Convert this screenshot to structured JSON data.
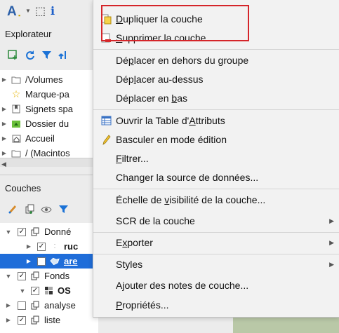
{
  "left_panel": {
    "toolbar_glyph": "A",
    "explorer_title": "Explorateur",
    "explorer_items": [
      {
        "label": "/Volumes",
        "icon": "folder-icon"
      },
      {
        "label": "Marque-pa",
        "icon": "star-icon"
      },
      {
        "label": "Signets spa",
        "icon": "bookmark-icon"
      },
      {
        "label": "Dossier du",
        "icon": "home-folder-icon"
      },
      {
        "label": "Accueil",
        "icon": "home-icon"
      },
      {
        "label": "/ (Macintos",
        "icon": "folder-icon"
      }
    ],
    "layers_title": "Couches",
    "layer_items": [
      {
        "label": "Donné"
      },
      {
        "label": "ruc"
      },
      {
        "label": "are"
      },
      {
        "label": "Fonds"
      },
      {
        "label": "OS"
      },
      {
        "label": "analyse"
      },
      {
        "label": "liste"
      }
    ]
  },
  "context_menu": {
    "items": [
      {
        "label": "Dupliquer la couche",
        "u": "D",
        "icon": "duplicate-layer-icon"
      },
      {
        "label": "Supprimer la couche",
        "u": "S",
        "icon": "remove-layer-icon"
      },
      {
        "label": "Déplacer en dehors du groupe",
        "u": "p"
      },
      {
        "label": "Déplacer au-dessus",
        "u": "l"
      },
      {
        "label": "Déplacer en bas",
        "u": "b"
      },
      {
        "label": "Ouvrir la Table d'Attributs",
        "u": "A",
        "icon": "attribute-table-icon"
      },
      {
        "label": "Basculer en mode édition",
        "icon": "pencil-icon"
      },
      {
        "label": "Filtrer...",
        "u": "F"
      },
      {
        "label": "Changer la source de données..."
      },
      {
        "label": "Échelle de visibilité de la couche...",
        "u": "v"
      },
      {
        "label": "SCR de la couche",
        "submenu": true
      },
      {
        "label": "Exporter",
        "u": "x",
        "submenu": true
      },
      {
        "label": "Styles",
        "submenu": true
      },
      {
        "label": "Ajouter des notes de couche..."
      },
      {
        "label": "Propriétés...",
        "u": "P"
      }
    ]
  },
  "colors": {
    "highlight_box": "#d5252a",
    "selection": "#1f6dd9"
  }
}
